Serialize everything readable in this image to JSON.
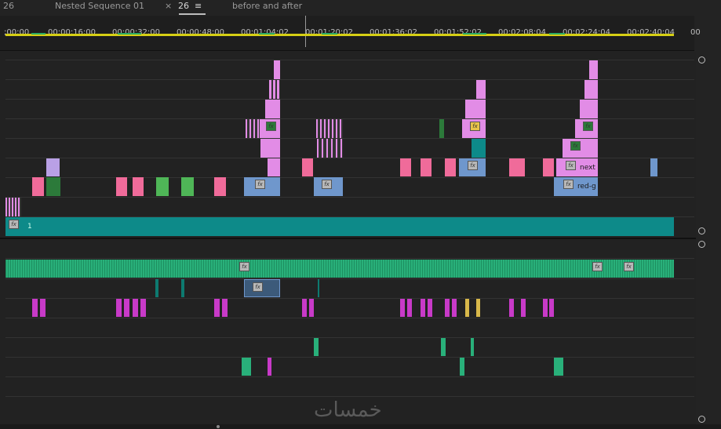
{
  "tabs": {
    "left_fragment": "26",
    "nested": "Nested Sequence 01",
    "close_glyph": "×",
    "active": "26",
    "menu_glyph": "≡",
    "before_after": "before and after"
  },
  "ruler": {
    "labels": [
      ";00;00",
      "00;00;16;00",
      "00;00;32;00",
      "00;00;48;00",
      "00;01;04;02",
      "00;01;20;02",
      "00;01;36;02",
      "00;01;52;02",
      "00;02;08;04",
      "00;02;24;04",
      "00;02;40;04",
      "00"
    ]
  },
  "clips": {
    "base_label": "1",
    "next_label": "next",
    "redg_label": "red-g",
    "fx_glyph": "fx"
  },
  "watermark": "خمسات",
  "colors": {
    "pink": "#f06b9a",
    "violet": "#e28ce6",
    "blue": "#6f97cc",
    "teal": "#0d8a89",
    "green": "#4fb657",
    "audio": "#29b07a",
    "audio_magenta": "#c83ac8"
  }
}
